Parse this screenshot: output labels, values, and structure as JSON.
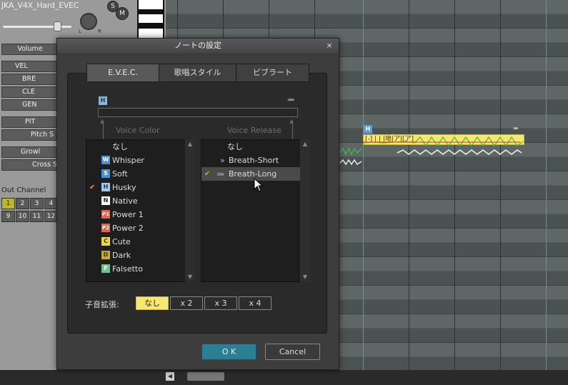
{
  "track": {
    "name": "JKA_V4X_Hard_EVEC",
    "pan_l": "L",
    "pan_r": "R",
    "solo": "S",
    "mute": "M"
  },
  "params": {
    "volume": "Volume",
    "vel": "VEL",
    "bre": "BRE",
    "cle": "CLE",
    "gen": "GEN",
    "pit": "PIT",
    "pitch_s": "Pitch S",
    "growl": "Growl",
    "cross_s": "Cross S"
  },
  "out_channel": {
    "label": "Out Channel",
    "row1": [
      "1",
      "2",
      "3",
      "4"
    ],
    "row2": [
      "9",
      "10",
      "11",
      "12"
    ]
  },
  "note": {
    "lyric": "[-] | | |地|ア|[ア]",
    "marker": "H",
    "arrow": "»»"
  },
  "dialog": {
    "title": "ノートの設定",
    "close": "×",
    "tabs": [
      "E.V.E.C.",
      "歌唱スタイル",
      "ビブラート"
    ],
    "marker": "H",
    "arrows": "»»»",
    "voice_color_label": "Voice Color",
    "voice_release_label": "Voice Release",
    "voice_color": [
      {
        "label": "なし",
        "icon": "",
        "checked": false
      },
      {
        "label": "Whisper",
        "icon": "W",
        "checked": false
      },
      {
        "label": "Soft",
        "icon": "S",
        "checked": false
      },
      {
        "label": "Husky",
        "icon": "H",
        "checked": true
      },
      {
        "label": "Native",
        "icon": "N",
        "checked": false
      },
      {
        "label": "Power 1",
        "icon": "P1",
        "checked": false
      },
      {
        "label": "Power 2",
        "icon": "P2",
        "checked": false
      },
      {
        "label": "Cute",
        "icon": "C",
        "checked": false
      },
      {
        "label": "Dark",
        "icon": "D",
        "checked": false
      },
      {
        "label": "Falsetto",
        "icon": "F",
        "checked": false
      }
    ],
    "voice_release": [
      {
        "label": "なし",
        "prefix": "",
        "checked": false
      },
      {
        "label": "Breath-Short",
        "prefix": "»",
        "checked": false
      },
      {
        "label": "Breath-Long",
        "prefix": "»»",
        "checked": true
      }
    ],
    "consonant": {
      "label": "子音拡張:",
      "options": [
        "なし",
        "x 2",
        "x 3",
        "x 4"
      ],
      "selected": "なし"
    },
    "ok": "O K",
    "cancel": "Cancel"
  },
  "colors": {
    "whisper": "#4a90d9",
    "soft": "#4a90d9",
    "husky": "#a8c8e8",
    "native": "#ffffff",
    "power": "#e8624a",
    "cute": "#f0d840",
    "dark": "#c8a830",
    "falsetto": "#6cc48a",
    "note": "#f6e76e",
    "ok": "#2a7f95",
    "check": "#e39a2c"
  }
}
